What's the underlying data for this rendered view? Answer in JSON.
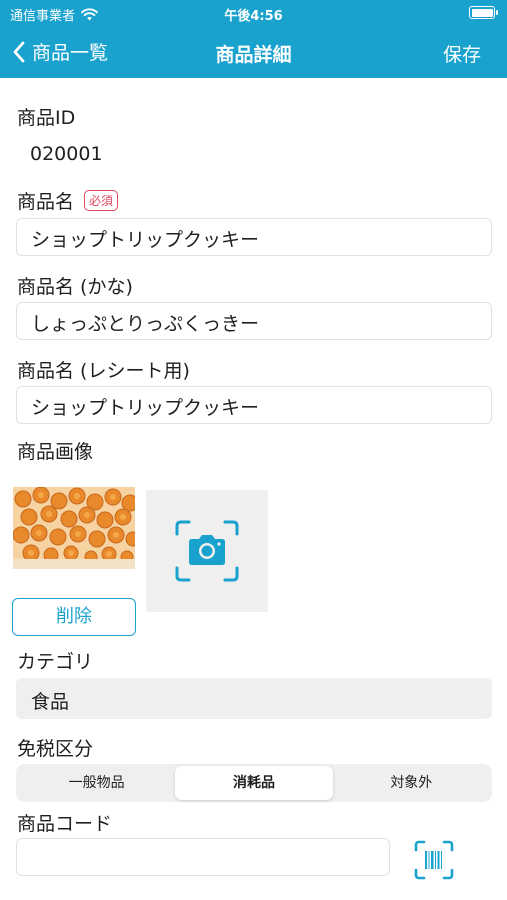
{
  "status_bar": {
    "carrier": "通信事業者",
    "time": "午後4:56"
  },
  "nav": {
    "back_label": "商品一覧",
    "title": "商品詳細",
    "save_label": "保存"
  },
  "form": {
    "product_id": {
      "label": "商品ID",
      "value": "020001"
    },
    "product_name": {
      "label": "商品名",
      "required_badge": "必須",
      "value": "ショップトリップクッキー"
    },
    "product_name_kana": {
      "label": "商品名 (かな)",
      "value": "しょっぷとりっぷくっきー"
    },
    "product_name_receipt": {
      "label": "商品名 (レシート用)",
      "value": "ショップトリップクッキー"
    },
    "product_image": {
      "label": "商品画像",
      "delete_label": "削除"
    },
    "category": {
      "label": "カテゴリ",
      "value": "食品"
    },
    "tax_exempt": {
      "label": "免税区分",
      "options": [
        "一般物品",
        "消耗品",
        "対象外"
      ],
      "selected": "消耗品"
    },
    "product_code": {
      "label": "商品コード",
      "value": ""
    }
  },
  "colors": {
    "accent": "#1aa2cf",
    "required": "#e0485f",
    "field_grey": "#efefef"
  },
  "icons": [
    "wifi-icon",
    "battery-icon",
    "back-chevron-icon",
    "camera-icon",
    "barcode-scan-icon"
  ]
}
